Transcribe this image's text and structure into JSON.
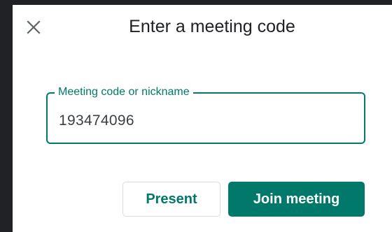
{
  "dialog": {
    "title": "Enter a meeting code",
    "close_icon": "close-icon"
  },
  "field": {
    "label": "Meeting code or nickname",
    "value": "193474096"
  },
  "actions": {
    "present_label": "Present",
    "join_label": "Join meeting"
  },
  "colors": {
    "accent": "#00796b",
    "background": "#202124",
    "surface": "#ffffff"
  }
}
